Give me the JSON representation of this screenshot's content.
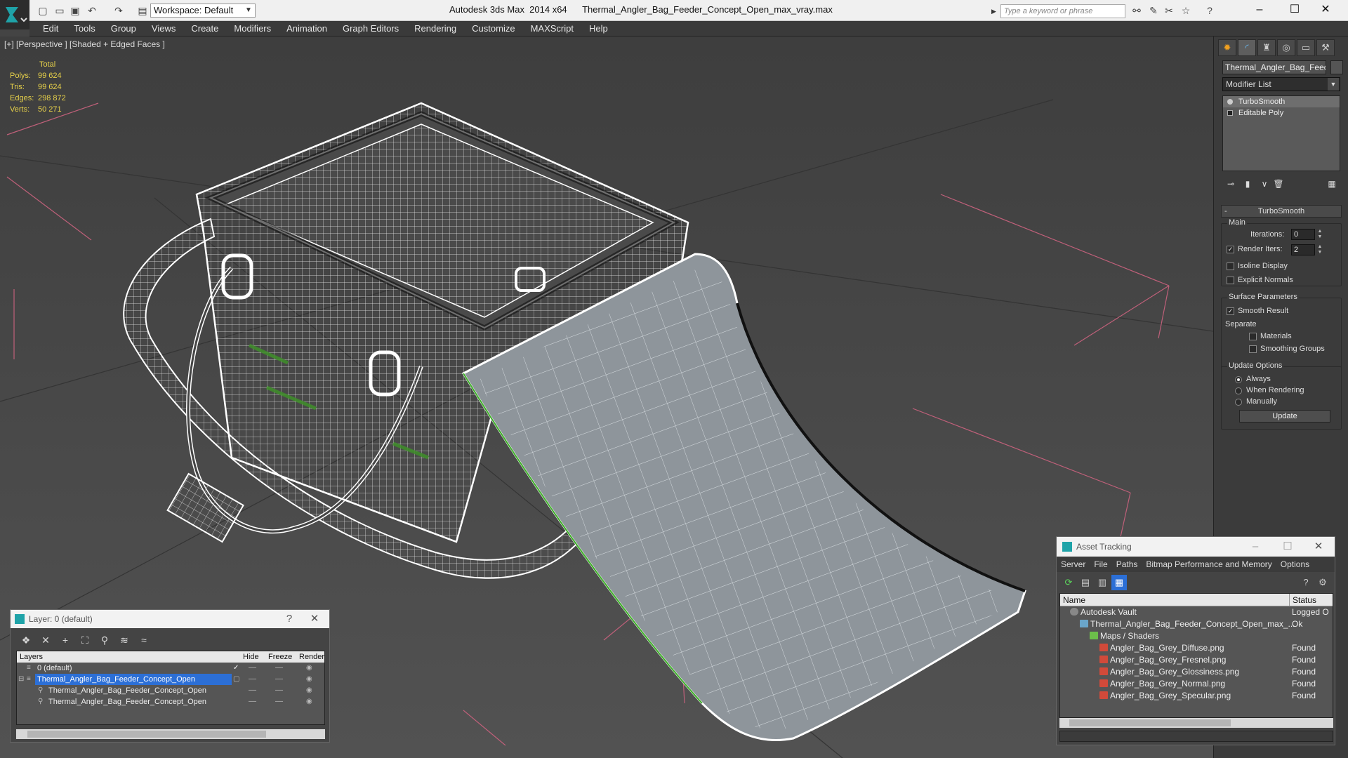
{
  "titlebar": {
    "workspace_label": "Workspace: Default",
    "app_title": "Autodesk 3ds Max  2014 x64",
    "file_title": "Thermal_Angler_Bag_Feeder_Concept_Open_max_vray.max",
    "search_placeholder": "Type a keyword or phrase"
  },
  "menu": [
    "Edit",
    "Tools",
    "Group",
    "Views",
    "Create",
    "Modifiers",
    "Animation",
    "Graph Editors",
    "Rendering",
    "Customize",
    "MAXScript",
    "Help"
  ],
  "viewport": {
    "label": "[+] [Perspective ] [Shaded + Edged Faces ]",
    "stats": {
      "header": "Total",
      "rows": [
        {
          "label": "Polys:",
          "value": "99 624"
        },
        {
          "label": "Tris:",
          "value": "99 624"
        },
        {
          "label": "Edges:",
          "value": "298 872"
        },
        {
          "label": "Verts:",
          "value": "50 271"
        }
      ]
    }
  },
  "command_panel": {
    "object_name": "Thermal_Angler_Bag_Feeder",
    "modifier_list": "Modifier List",
    "stack": [
      "TurboSmooth",
      "Editable Poly"
    ],
    "rollout_title": "TurboSmooth",
    "main_label": "Main",
    "iterations_label": "Iterations:",
    "iterations_value": "0",
    "render_iters_label": "Render Iters:",
    "render_iters_value": "2",
    "isoline_label": "Isoline Display",
    "explicit_normals_label": "Explicit Normals",
    "surface_label": "Surface Parameters",
    "smooth_result_label": "Smooth Result",
    "separate_label": "Separate",
    "materials_label": "Materials",
    "smoothing_groups_label": "Smoothing Groups",
    "update_options_label": "Update Options",
    "always_label": "Always",
    "when_rendering_label": "When Rendering",
    "manually_label": "Manually",
    "update_button": "Update"
  },
  "layer_window": {
    "title": "Layer: 0 (default)",
    "help": "?",
    "columns": {
      "layers": "Layers",
      "hide": "Hide",
      "freeze": "Freeze",
      "render": "Render"
    },
    "rows": [
      {
        "name": "0 (default)"
      },
      {
        "name": "Thermal_Angler_Bag_Feeder_Concept_Open"
      },
      {
        "name": "Thermal_Angler_Bag_Feeder_Concept_Open"
      },
      {
        "name": "Thermal_Angler_Bag_Feeder_Concept_Open"
      }
    ]
  },
  "asset_window": {
    "title": "Asset Tracking",
    "menu": [
      "Server",
      "File",
      "Paths",
      "Bitmap Performance and Memory",
      "Options"
    ],
    "columns": {
      "name": "Name",
      "status": "Status"
    },
    "rows": [
      {
        "name": "Autodesk Vault",
        "status": "Logged O"
      },
      {
        "name": "Thermal_Angler_Bag_Feeder_Concept_Open_max_...",
        "status": "Ok"
      },
      {
        "name": "Maps / Shaders",
        "status": ""
      },
      {
        "name": "Angler_Bag_Grey_Diffuse.png",
        "status": "Found"
      },
      {
        "name": "Angler_Bag_Grey_Fresnel.png",
        "status": "Found"
      },
      {
        "name": "Angler_Bag_Grey_Glossiness.png",
        "status": "Found"
      },
      {
        "name": "Angler_Bag_Grey_Normal.png",
        "status": "Found"
      },
      {
        "name": "Angler_Bag_Grey_Specular.png",
        "status": "Found"
      }
    ]
  },
  "colors": {
    "selection_blue": "#2c6fd6",
    "stats_yellow": "#e8d24a",
    "grid_pink": "#c0607a"
  }
}
